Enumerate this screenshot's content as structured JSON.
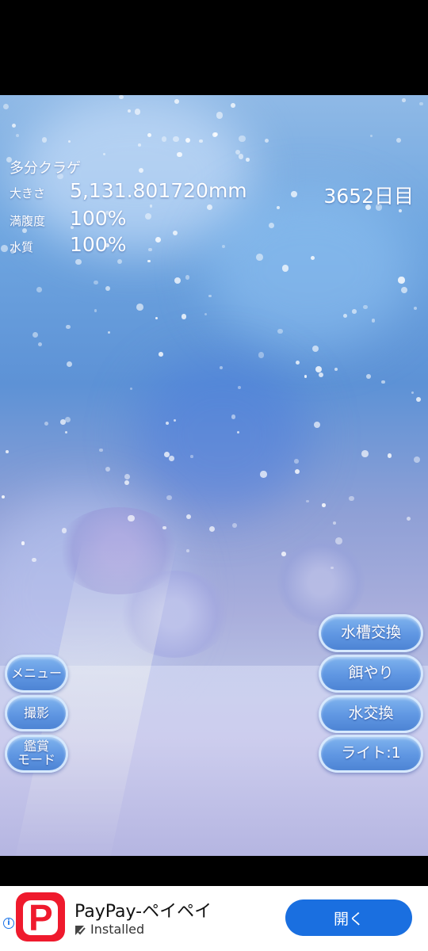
{
  "hud": {
    "jellyfish_name": "多分クラゲ",
    "size_label": "大きさ",
    "size_value": "5,131.801720mm",
    "day": "3652日目",
    "fullness_label": "満腹度",
    "fullness_value": "100%",
    "water_quality_label": "水質",
    "water_quality_value": "100%"
  },
  "left_buttons": {
    "menu": "メニュー",
    "photo": "撮影",
    "appreciation_mode": "鑑賞\nモード"
  },
  "right_buttons": {
    "tank_change": "水槽交換",
    "feed": "餌やり",
    "water_change": "水交換",
    "light": "ライト:1"
  },
  "ad": {
    "app_name": "PayPay-ペイペイ",
    "status": "Installed",
    "cta": "開く",
    "logo_letter": "P",
    "brand_color": "#ef1a2d",
    "cta_color": "#1a6fe0"
  }
}
